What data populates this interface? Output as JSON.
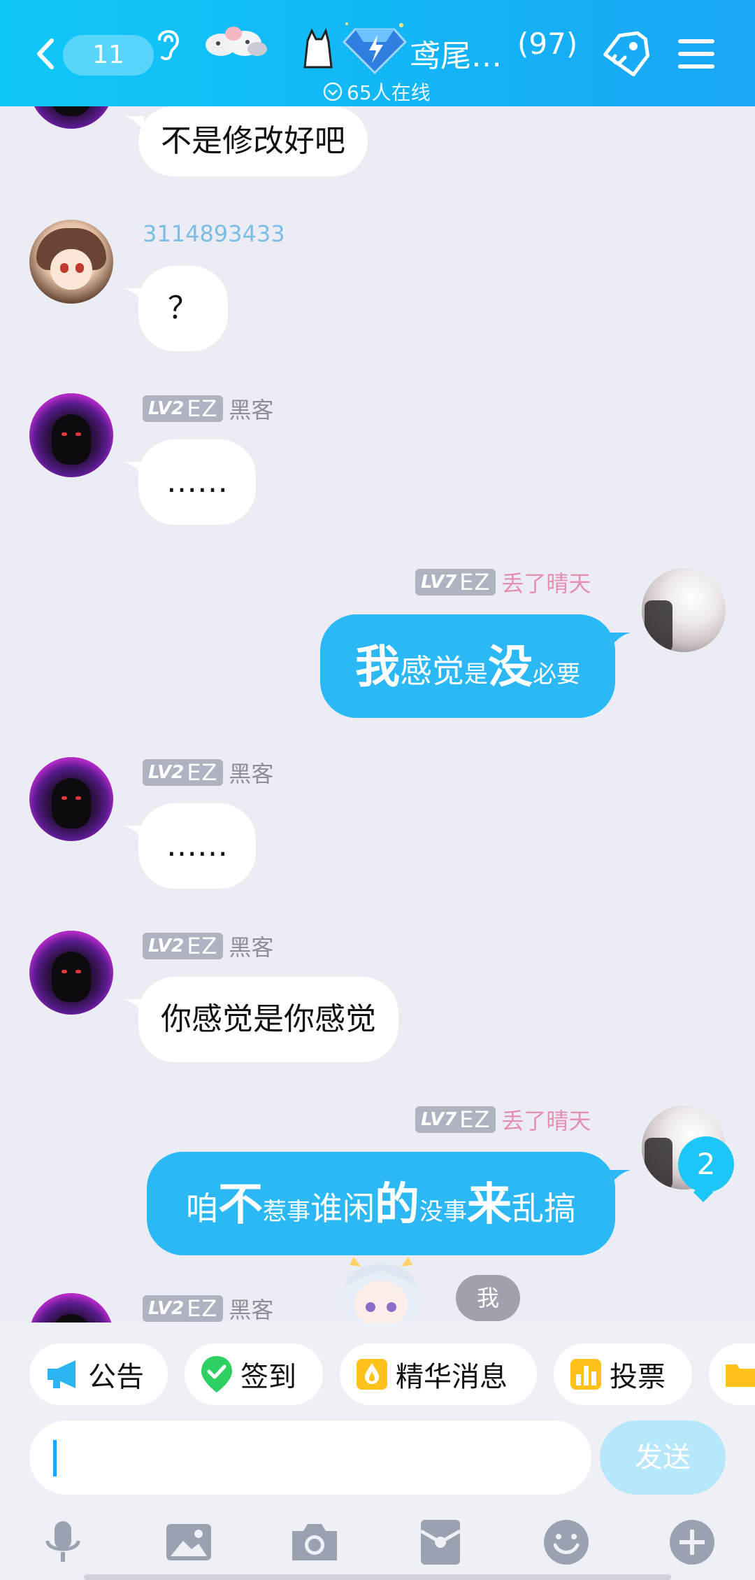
{
  "header": {
    "unread_count": "11",
    "group_title": "鸢尾…",
    "member_count": "(97)",
    "online_text": "65人在线"
  },
  "messages": [
    {
      "side": "left",
      "text": "不是修改好吧"
    },
    {
      "side": "left",
      "sender": "3114893433",
      "text": "？"
    },
    {
      "side": "left",
      "level": "LV2",
      "badge": "EZ",
      "sender": "黑客",
      "text": "……"
    },
    {
      "side": "right",
      "level": "LV7",
      "badge": "EZ",
      "sender": "丢了晴天",
      "segments": [
        "我",
        "感觉",
        "是",
        "没",
        "必要"
      ]
    },
    {
      "side": "left",
      "level": "LV2",
      "badge": "EZ",
      "sender": "黑客",
      "text": "……"
    },
    {
      "side": "left",
      "level": "LV2",
      "badge": "EZ",
      "sender": "黑客",
      "text": "你感觉是你感觉"
    },
    {
      "side": "right",
      "level": "LV7",
      "badge": "EZ",
      "sender": "丢了晴天",
      "segments": [
        "咱",
        "不",
        "惹事",
        "谁闲",
        "的",
        "没事",
        "来",
        "乱搞"
      ]
    },
    {
      "side": "left",
      "level": "LV2",
      "badge": "EZ",
      "sender": "黑客"
    }
  ],
  "unread_new": "2",
  "me_pill": "我",
  "quick_actions": [
    {
      "label": "公告",
      "icon": "megaphone-icon"
    },
    {
      "label": "签到",
      "icon": "checkin-icon"
    },
    {
      "label": "精华消息",
      "icon": "essence-icon"
    },
    {
      "label": "投票",
      "icon": "vote-icon"
    },
    {
      "label": "",
      "icon": "folder-icon"
    }
  ],
  "input": {
    "value": "",
    "placeholder": ""
  },
  "send_label": "发送",
  "toolbar": [
    "mic-icon",
    "image-icon",
    "camera-icon",
    "red-packet-icon",
    "emoji-icon",
    "plus-icon"
  ],
  "colors": {
    "header": "#13b4f6",
    "bubble_self": "#2bb8f5",
    "background": "#ececf4",
    "send_disabled": "#b7e7fb"
  }
}
